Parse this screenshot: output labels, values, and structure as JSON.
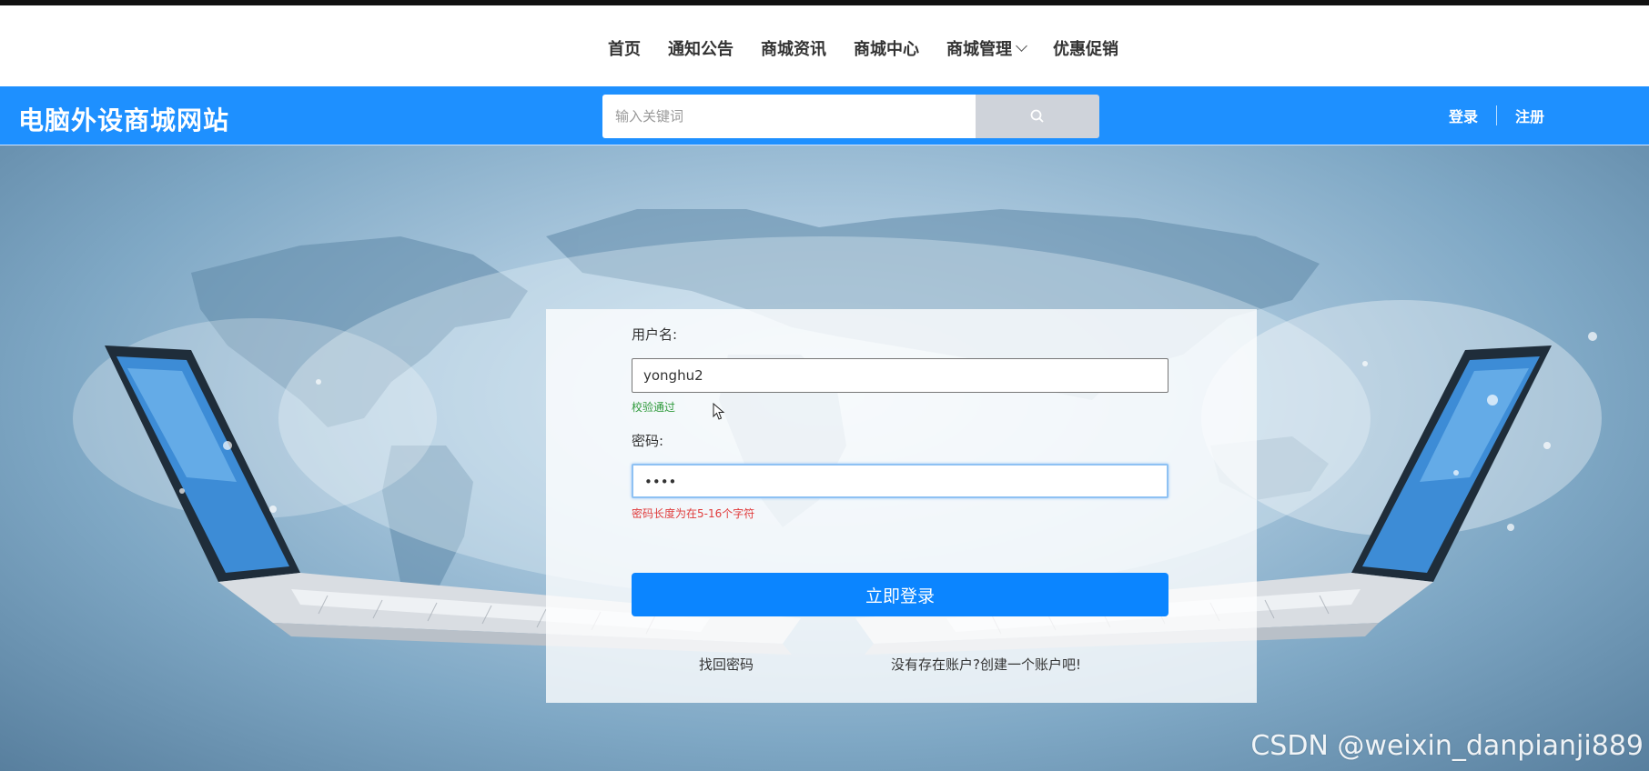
{
  "nav": {
    "items": [
      {
        "label": "首页"
      },
      {
        "label": "通知公告"
      },
      {
        "label": "商城资讯"
      },
      {
        "label": "商城中心"
      },
      {
        "label": "商城管理",
        "dropdown": true
      },
      {
        "label": "优惠促销"
      }
    ]
  },
  "header": {
    "brand": "电脑外设商城网站",
    "search": {
      "placeholder": "输入关键词",
      "icon": "search-icon"
    },
    "auth": {
      "login": "登录",
      "register": "注册"
    }
  },
  "login_form": {
    "username_label": "用户名:",
    "username_value": "yonghu2",
    "username_hint": "校验通过",
    "password_label": "密码:",
    "password_value": "••••",
    "password_hint": "密码长度为在5-16个字符",
    "submit_label": "立即登录",
    "forgot_link": "找回密码",
    "register_link": "没有存在账户?创建一个账户吧!"
  },
  "watermark": "CSDN @weixin_danpianji889",
  "colors": {
    "primary": "#1e90ff",
    "button": "#0b85ff",
    "success": "#2e9a3b",
    "error": "#e03b3b"
  }
}
